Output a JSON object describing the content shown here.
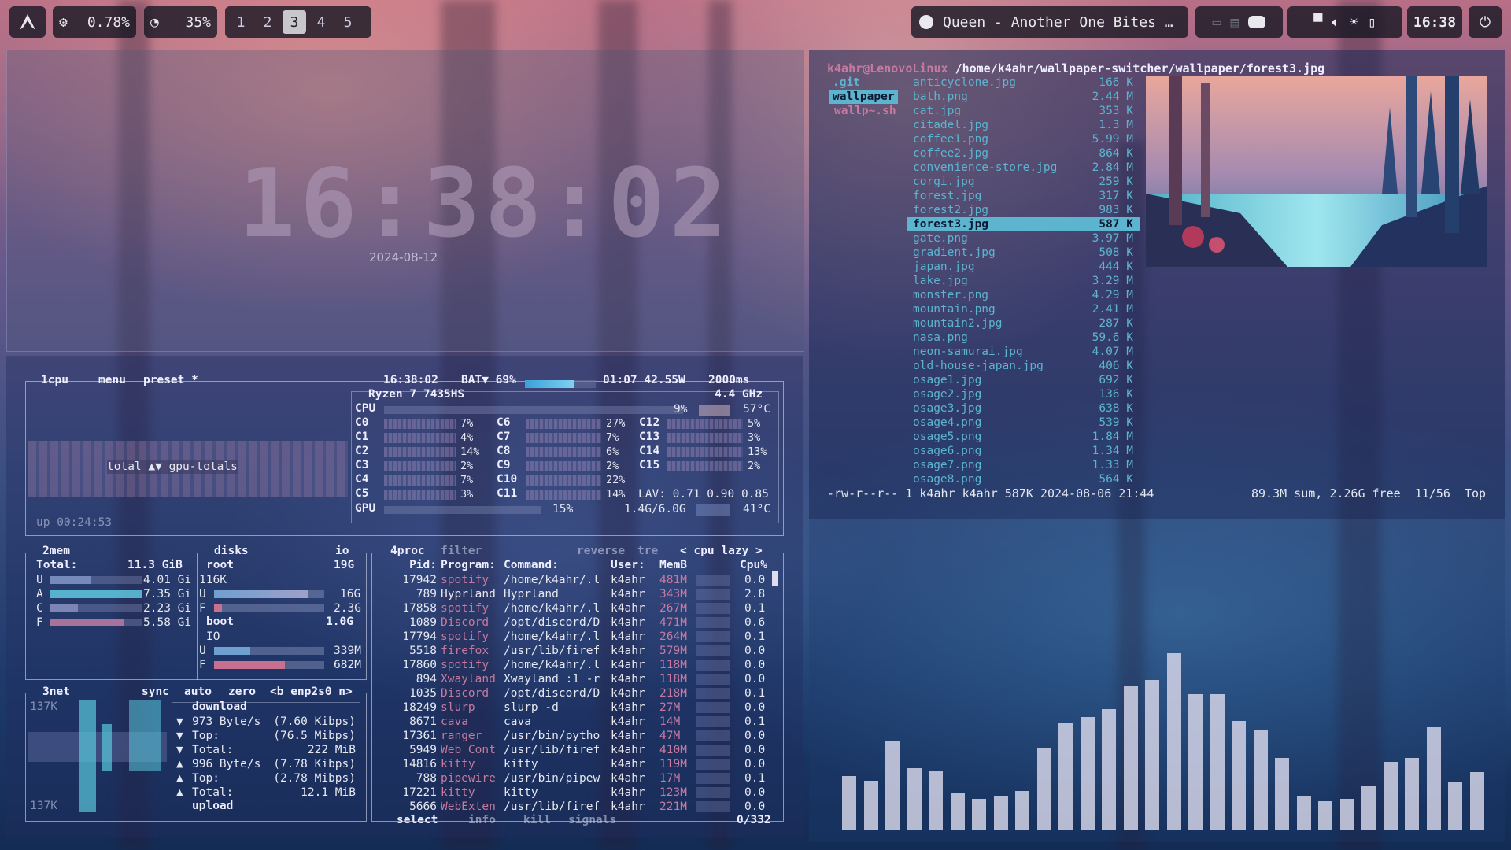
{
  "topbar": {
    "cpu_value": "0.78%",
    "mem_value": "35%",
    "workspaces": [
      "1",
      "2",
      "3",
      "4",
      "5"
    ],
    "active_workspace": "3",
    "media_title": "Queen - Another One Bites …",
    "clock": "16:38"
  },
  "clock_widget": {
    "time": "16:38:02",
    "date": "2024-08-12"
  },
  "btop": {
    "cpu_tab": "1cpu",
    "menu_tab": "menu",
    "preset_tab": "preset *",
    "header_time": "16:38:02",
    "battery": "BAT▼ 69%",
    "battery_time": "01:07 42.55W",
    "interval": "2000ms",
    "cpu_model": "Ryzen 7 7435HS",
    "cpu_freq": "4.4 GHz",
    "cpu_total_pct": "9%",
    "cpu_temp": "57°C",
    "cores_left": [
      [
        "C0",
        "7%"
      ],
      [
        "C1",
        "4%"
      ],
      [
        "C2",
        "14%"
      ],
      [
        "C3",
        "2%"
      ],
      [
        "C4",
        "7%"
      ],
      [
        "C5",
        "3%"
      ]
    ],
    "cores_mid": [
      [
        "C6",
        "27%"
      ],
      [
        "C7",
        "7%"
      ],
      [
        "C8",
        "6%"
      ],
      [
        "C9",
        "2%"
      ],
      [
        "C10",
        "22%"
      ],
      [
        "C11",
        "14%"
      ]
    ],
    "cores_right": [
      [
        "C12",
        "5%"
      ],
      [
        "C13",
        "3%"
      ],
      [
        "C14",
        "13%"
      ],
      [
        "C15",
        "2%"
      ]
    ],
    "lav": "LAV: 0.71 0.90 0.85",
    "gpu_pct": "15%",
    "gpu_mem": "1.4G/6.0G",
    "gpu_temp": "41°C",
    "graph_label": "total ▲▼ gpu-totals",
    "uptime": "up 00:24:53",
    "mem": {
      "tab": "2mem",
      "total_label": "Total:",
      "total": "11.3 GiB",
      "rows": [
        [
          "U",
          "4.01 Gi"
        ],
        [
          "A",
          "7.35 Gi"
        ],
        [
          "C",
          "2.23 Gi"
        ],
        [
          "F",
          "5.58 Gi"
        ]
      ]
    },
    "disks": {
      "tab": "disks",
      "io": "io",
      "root": "root",
      "root_size": "19G",
      "root_io": "116K",
      "root_u": "16G",
      "root_f": "2.3G",
      "boot": "boot",
      "boot_size": "1.0G",
      "boot_io": "IO",
      "boot_u": "339M",
      "boot_f": "682M"
    },
    "net": {
      "tab": "3net",
      "sync": "sync",
      "auto": "auto",
      "zero": "zero",
      "iface": "<b enp2s0 n>",
      "scale_top": "137K",
      "scale_bottom": "137K",
      "download": "download",
      "rows": [
        [
          "▼",
          "973 Byte/s",
          "(7.60 Kibps)"
        ],
        [
          "▼",
          "Top:",
          "(76.5 Mibps)"
        ],
        [
          "▼",
          "Total:",
          "222 MiB"
        ],
        [
          "▲",
          "996 Byte/s",
          "(7.78 Kibps)"
        ],
        [
          "▲",
          "Top:",
          "(2.78 Mibps)"
        ],
        [
          "▲",
          "Total:",
          "12.1 MiB"
        ]
      ],
      "upload": "upload"
    },
    "proc": {
      "tab": "4proc",
      "filter": "filter",
      "reverse": "reverse",
      "tree": "tre",
      "sort": "< cpu lazy >",
      "headers": [
        "Pid:",
        "Program:",
        "Command:",
        "User:",
        "MemB",
        "Cpu%"
      ],
      "rows": [
        [
          "17942",
          "spotify",
          "/home/k4ahr/.l",
          "k4ahr",
          "481M",
          "0.0"
        ],
        [
          "789",
          "Hyprland",
          "Hyprland",
          "k4ahr",
          "343M",
          "2.8"
        ],
        [
          "17858",
          "spotify",
          "/home/k4ahr/.l",
          "k4ahr",
          "267M",
          "0.1"
        ],
        [
          "1089",
          "Discord",
          "/opt/discord/D",
          "k4ahr",
          "471M",
          "0.6"
        ],
        [
          "17794",
          "spotify",
          "/home/k4ahr/.l",
          "k4ahr",
          "264M",
          "0.1"
        ],
        [
          "5518",
          "firefox",
          "/usr/lib/firef",
          "k4ahr",
          "579M",
          "0.0"
        ],
        [
          "17860",
          "spotify",
          "/home/k4ahr/.l",
          "k4ahr",
          "118M",
          "0.0"
        ],
        [
          "894",
          "Xwayland",
          "Xwayland :1 -r",
          "k4ahr",
          "118M",
          "0.0"
        ],
        [
          "1035",
          "Discord",
          "/opt/discord/D",
          "k4ahr",
          "218M",
          "0.1"
        ],
        [
          "18249",
          "slurp",
          "slurp -d",
          "k4ahr",
          "27M",
          "0.0"
        ],
        [
          "8671",
          "cava",
          "cava",
          "k4ahr",
          "14M",
          "0.1"
        ],
        [
          "17361",
          "ranger",
          "/usr/bin/pytho",
          "k4ahr",
          "47M",
          "0.0"
        ],
        [
          "5949",
          "Web Cont",
          "/usr/lib/firef",
          "k4ahr",
          "410M",
          "0.0"
        ],
        [
          "14816",
          "kitty",
          "kitty",
          "k4ahr",
          "119M",
          "0.0"
        ],
        [
          "788",
          "pipewire",
          "/usr/bin/pipew",
          "k4ahr",
          "17M",
          "0.1"
        ],
        [
          "17221",
          "kitty",
          "kitty",
          "k4ahr",
          "123M",
          "0.0"
        ],
        [
          "5666",
          "WebExten",
          "/usr/lib/firef",
          "k4ahr",
          "221M",
          "0.0"
        ]
      ],
      "footer_select": "select",
      "footer_info": "info",
      "footer_kill": "kill",
      "footer_signals": "signals",
      "count": "0/332"
    }
  },
  "ranger": {
    "host": "k4ahr@LenovoLinux",
    "path": "/home/k4ahr/wallpaper-switcher/wallpaper/forest3.jpg",
    "parent_items": [
      ".git",
      "wallpaper",
      "wallp~.sh"
    ],
    "files": [
      [
        "anticyclone.jpg",
        "166 K"
      ],
      [
        "bath.png",
        "2.44 M"
      ],
      [
        "cat.jpg",
        "353 K"
      ],
      [
        "citadel.jpg",
        "1.3 M"
      ],
      [
        "coffee1.png",
        "5.99 M"
      ],
      [
        "coffee2.jpg",
        "864 K"
      ],
      [
        "convenience-store.jpg",
        "2.84 M"
      ],
      [
        "corgi.jpg",
        "259 K"
      ],
      [
        "forest.jpg",
        "317 K"
      ],
      [
        "forest2.jpg",
        "983 K"
      ],
      [
        "forest3.jpg",
        "587 K"
      ],
      [
        "gate.png",
        "3.97 M"
      ],
      [
        "gradient.jpg",
        "508 K"
      ],
      [
        "japan.jpg",
        "444 K"
      ],
      [
        "lake.jpg",
        "3.29 M"
      ],
      [
        "monster.png",
        "4.29 M"
      ],
      [
        "mountain.png",
        "2.41 M"
      ],
      [
        "mountain2.jpg",
        "287 K"
      ],
      [
        "nasa.png",
        "59.6 K"
      ],
      [
        "neon-samurai.jpg",
        "4.07 M"
      ],
      [
        "old-house-japan.jpg",
        "406 K"
      ],
      [
        "osage1.jpg",
        "692 K"
      ],
      [
        "osage2.jpg",
        "136 K"
      ],
      [
        "osage3.jpg",
        "638 K"
      ],
      [
        "osage4.png",
        "539 K"
      ],
      [
        "osage5.png",
        "1.84 M"
      ],
      [
        "osage6.png",
        "1.34 M"
      ],
      [
        "osage7.png",
        "1.33 M"
      ],
      [
        "osage8.png",
        "564 K"
      ]
    ],
    "selected": "forest3.jpg",
    "status_left": "-rw-r--r-- 1 k4ahr k4ahr 587K 2024-08-06 21:44",
    "status_right": "89.3M sum, 2.26G free  11/56  Top"
  },
  "cava_levels": [
    0.26,
    0.24,
    0.43,
    0.3,
    0.29,
    0.18,
    0.15,
    0.16,
    0.19,
    0.4,
    0.52,
    0.55,
    0.59,
    0.7,
    0.73,
    0.86,
    0.66,
    0.66,
    0.53,
    0.49,
    0.35,
    0.16,
    0.14,
    0.15,
    0.21,
    0.33,
    0.35,
    0.5,
    0.23,
    0.28
  ]
}
